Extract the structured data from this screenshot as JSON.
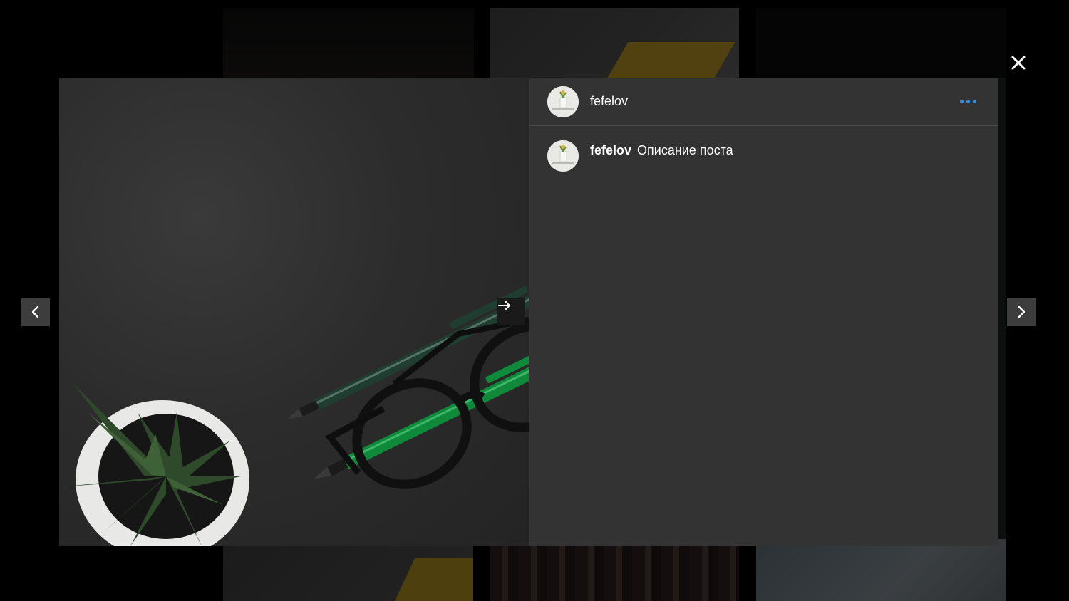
{
  "post": {
    "author": "fefelov",
    "caption_author": "fefelov",
    "caption_text": "Описание поста"
  },
  "icons": {
    "close": "close-icon",
    "prev": "chevron-left-icon",
    "next": "chevron-right-icon",
    "image_next": "arrow-right-icon",
    "more": "more-horizontal-icon"
  },
  "colors": {
    "backdrop": "#000000",
    "panel": "#333333",
    "accent": "#2f8ee6",
    "text": "#ffffff"
  }
}
